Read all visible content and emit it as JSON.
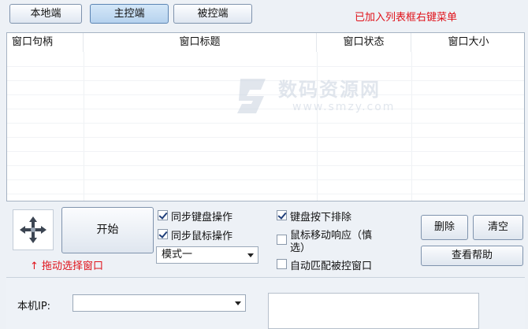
{
  "tabs": [
    {
      "label": "本地端",
      "active": false
    },
    {
      "label": "主控端",
      "active": true
    },
    {
      "label": "被控端",
      "active": false
    }
  ],
  "notice": "已加入列表框右键菜单",
  "list": {
    "columns": [
      "窗口句柄",
      "窗口标题",
      "窗口状态",
      "窗口大小"
    ]
  },
  "watermark": {
    "title": "数码资源网",
    "sub": "www.smzy.com"
  },
  "drag": {
    "tip": "↑ 拖动选择窗口",
    "icon": "move-crosshair-icon"
  },
  "controls": {
    "start_label": "开始",
    "sync_keyboard": {
      "label": "同步键盘操作",
      "checked": true
    },
    "sync_mouse": {
      "label": "同步鼠标操作",
      "checked": true
    },
    "mode_value": "模式一",
    "keyboard_exclude": {
      "label": "键盘按下排除",
      "checked": true
    },
    "mouse_move": {
      "label_line1": "鼠标移动响应（慎",
      "label_line2": "选）",
      "checked": false
    },
    "auto_match": {
      "label": "自动匹配被控窗口",
      "checked": false
    },
    "delete_label": "删除",
    "clear_label": "清空",
    "help_label": "查看帮助"
  },
  "bottom": {
    "local_ip_label": "本机IP:",
    "local_ip_value": ""
  },
  "colors": {
    "accent_red": "#e0121a",
    "background": "#edf1f6"
  }
}
